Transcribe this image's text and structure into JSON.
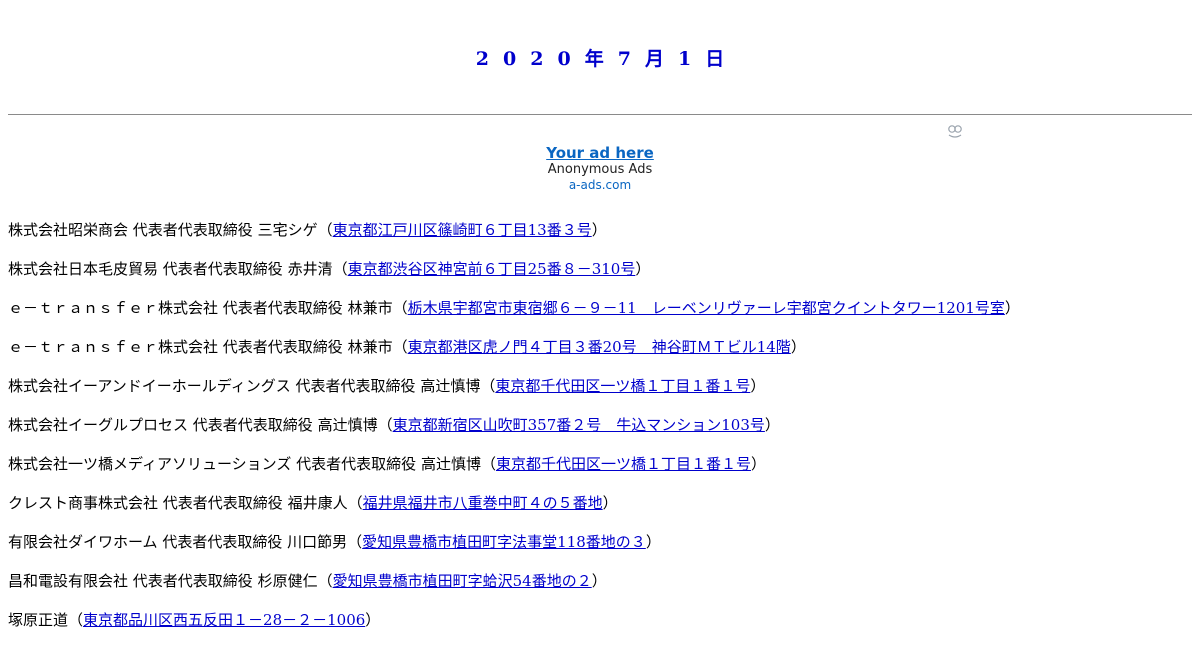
{
  "date_heading": [
    "2",
    "0",
    "2",
    "0",
    "年",
    "7",
    "月",
    "1",
    "日"
  ],
  "ad": {
    "title": "Your ad here",
    "subtitle": "Anonymous Ads",
    "domain": "a-ads.com",
    "badge_icon": "a-ads-logo-icon"
  },
  "entries": [
    {
      "company": "株式会社昭栄商会",
      "title": "代表者代表取締役",
      "name": "三宅シゲ",
      "address": "東京都江戸川区篠崎町６丁目13番３号"
    },
    {
      "company": "株式会社日本毛皮貿易",
      "title": "代表者代表取締役",
      "name": "赤井清",
      "address": "東京都渋谷区神宮前６丁目25番８－310号"
    },
    {
      "company": "ｅ－ｔｒａｎｓｆｅｒ株式会社",
      "title": "代表者代表取締役",
      "name": "林兼市",
      "address": "栃木県宇都宮市東宿郷６－９－11　レーベンリヴァーレ宇都宮クイントタワー1201号室"
    },
    {
      "company": "ｅ－ｔｒａｎｓｆｅｒ株式会社",
      "title": "代表者代表取締役",
      "name": "林兼市",
      "address": "東京都港区虎ノ門４丁目３番20号　神谷町ＭＴビル14階"
    },
    {
      "company": "株式会社イーアンドイーホールディングス",
      "title": "代表者代表取締役",
      "name": "高辻慎博",
      "address": "東京都千代田区一ツ橋１丁目１番１号"
    },
    {
      "company": "株式会社イーグルプロセス",
      "title": "代表者代表取締役",
      "name": "高辻慎博",
      "address": "東京都新宿区山吹町357番２号　牛込マンション103号"
    },
    {
      "company": "株式会社一ツ橋メディアソリューションズ",
      "title": "代表者代表取締役",
      "name": "高辻慎博",
      "address": "東京都千代田区一ツ橋１丁目１番１号"
    },
    {
      "company": "クレスト商事株式会社",
      "title": "代表者代表取締役",
      "name": "福井康人",
      "address": "福井県福井市八重巻中町４の５番地"
    },
    {
      "company": "有限会社ダイワホーム",
      "title": "代表者代表取締役",
      "name": "川口節男",
      "address": "愛知県豊橋市植田町字法事堂118番地の３"
    },
    {
      "company": "昌和電設有限会社",
      "title": "代表者代表取締役",
      "name": "杉原健仁",
      "address": "愛知県豊橋市植田町字蛤沢54番地の２"
    },
    {
      "company": "塚原正道",
      "title": "",
      "name": "",
      "address": "東京都品川区西五反田１－28－２－1006"
    }
  ]
}
